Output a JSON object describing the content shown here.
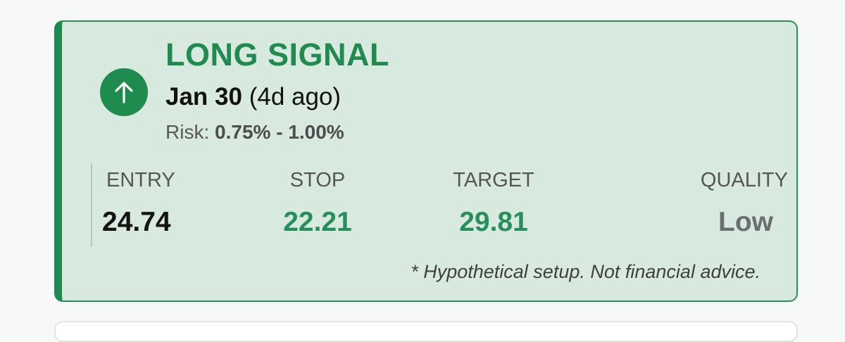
{
  "signal": {
    "title": "LONG SIGNAL",
    "direction_icon": "arrow-up-icon",
    "date": "Jan 30",
    "age": "(4d ago)",
    "risk_label": "Risk:",
    "risk_value": "0.75% - 1.00%"
  },
  "stats": {
    "entry": {
      "label": "ENTRY",
      "value": "24.74"
    },
    "stop": {
      "label": "STOP",
      "value": "22.21"
    },
    "target": {
      "label": "TARGET",
      "value": "29.81"
    },
    "quality": {
      "label": "QUALITY",
      "value": "Low"
    }
  },
  "disclaimer": "* Hypothetical setup. Not financial advice.",
  "colors": {
    "accent_green": "#1f8b4f",
    "card_background": "#d8e9e0",
    "quality_gray": "#6b6f70"
  }
}
